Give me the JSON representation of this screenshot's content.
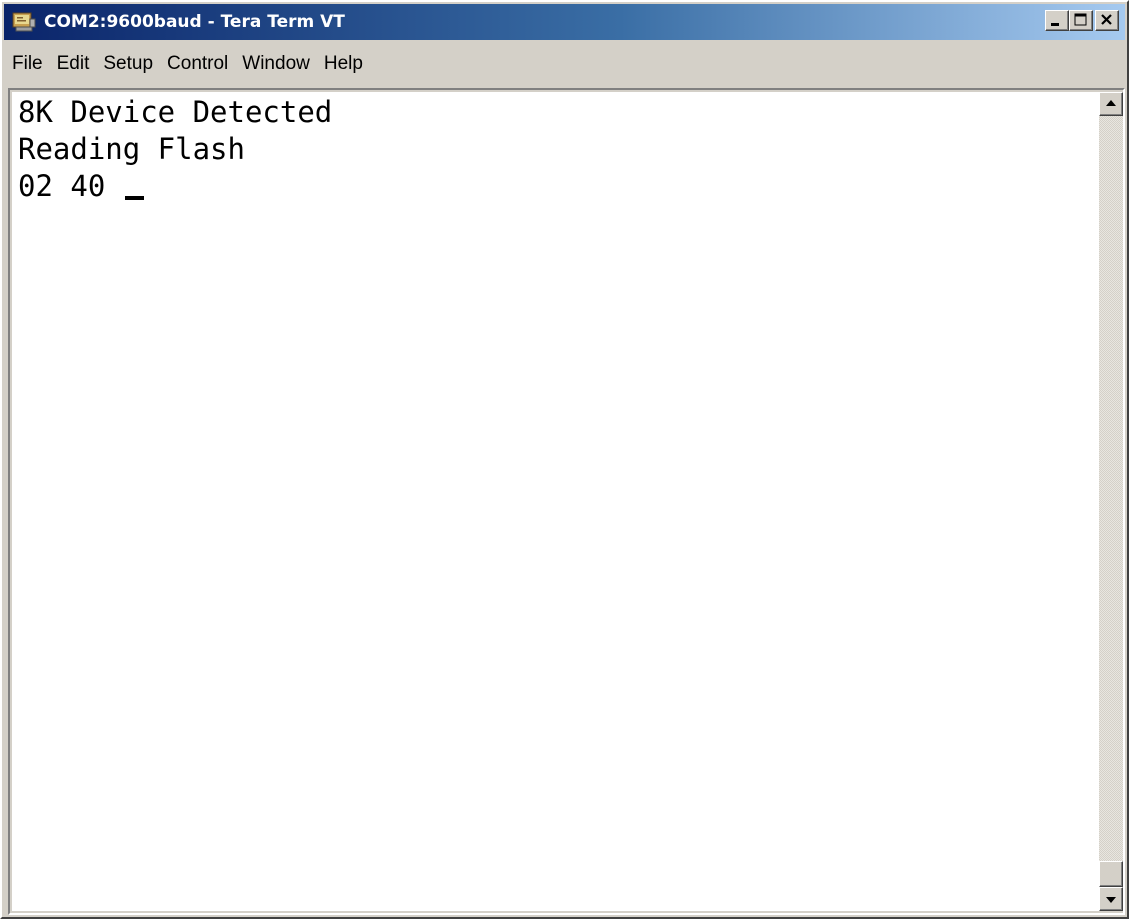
{
  "window": {
    "title": "COM2:9600baud - Tera Term VT",
    "icon": "teraterm-app-icon",
    "caption_buttons": [
      "minimize-icon",
      "maximize-icon",
      "close-icon"
    ]
  },
  "menu": {
    "items": [
      {
        "label": "File"
      },
      {
        "label": "Edit"
      },
      {
        "label": "Setup"
      },
      {
        "label": "Control"
      },
      {
        "label": "Window"
      },
      {
        "label": "Help"
      }
    ]
  },
  "terminal": {
    "lines": [
      "8K Device Detected",
      "Reading Flash",
      "02 40 "
    ],
    "cursor": "underline-cursor"
  },
  "scrollbar": {
    "up_icon": "scroll-up-arrow-icon",
    "down_icon": "scroll-down-arrow-icon"
  }
}
